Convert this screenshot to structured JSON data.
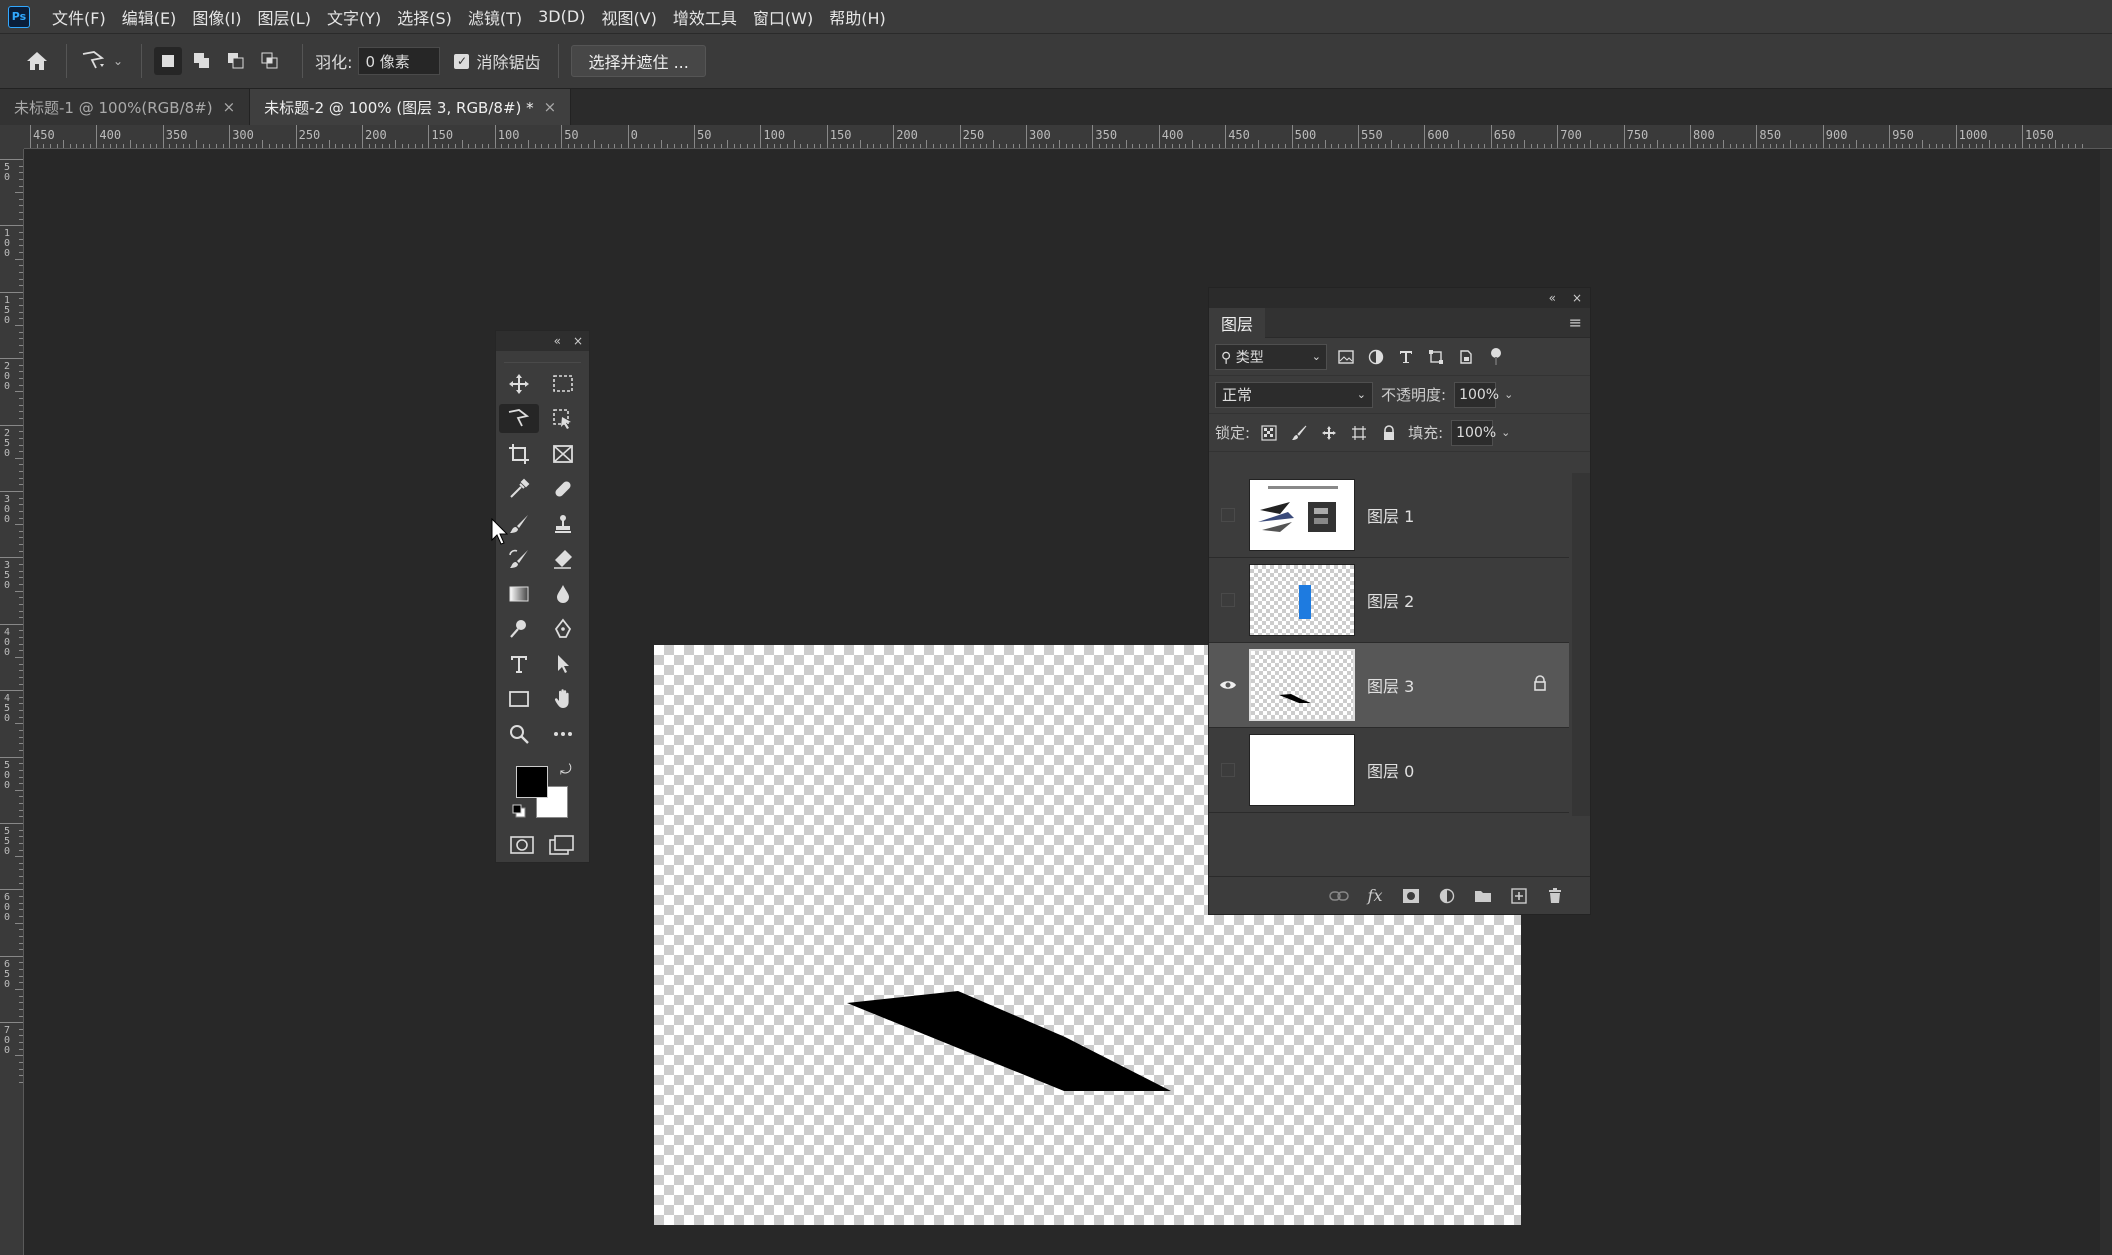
{
  "app": {
    "logo": "Ps"
  },
  "menu": [
    "文件(F)",
    "编辑(E)",
    "图像(I)",
    "图层(L)",
    "文字(Y)",
    "选择(S)",
    "滤镜(T)",
    "3D(D)",
    "视图(V)",
    "增效工具",
    "窗口(W)",
    "帮助(H)"
  ],
  "options": {
    "feather_label": "羽化:",
    "feather_value": "0 像素",
    "antialias_label": "消除锯齿",
    "antialias_checked": true,
    "select_mask_button": "选择并遮住 ..."
  },
  "tabs": [
    {
      "label": "未标题-1 @ 100%(RGB/8#)",
      "close": "×",
      "active": false
    },
    {
      "label": "未标题-2 @ 100% (图层 3, RGB/8#) *",
      "close": "×",
      "active": true
    }
  ],
  "ruler": {
    "top_labels": [
      "450",
      "400",
      "350",
      "300",
      "250",
      "200",
      "150",
      "100",
      "50",
      "0",
      "50",
      "100",
      "150",
      "200",
      "250",
      "300",
      "350",
      "400",
      "450",
      "500",
      "550",
      "600",
      "650",
      "700",
      "750",
      "800",
      "850",
      "900",
      "950",
      "1000",
      "1050"
    ],
    "left_labels": [
      "5 0",
      "1 0 0",
      "1 5 0",
      "2 0 0",
      "2 5 0",
      "3 0 0",
      "3 5 0",
      "4 0 0",
      "4 5 0",
      "5 0 0",
      "5 5 0",
      "6 0 0",
      "6 5 0",
      "7 0 0"
    ]
  },
  "toolbox": {
    "collapse": "«",
    "close": "×",
    "tools": [
      "move-tool",
      "marquee-tool",
      "polygonal-lasso-tool",
      "object-selection-tool",
      "crop-tool",
      "frame-tool",
      "eyedropper-tool",
      "spot-healing-tool",
      "brush-tool",
      "clone-stamp-tool",
      "history-brush-tool",
      "eraser-tool",
      "gradient-tool",
      "blur-tool",
      "dodge-tool",
      "pen-tool",
      "type-tool",
      "path-selection-tool",
      "rectangle-tool",
      "hand-tool",
      "zoom-tool",
      "more-tools"
    ],
    "foreground": "#000000",
    "background": "#ffffff"
  },
  "layers_panel": {
    "collapse": "«",
    "close": "×",
    "tab": "图层",
    "filter_label": "类型",
    "blend_mode": "正常",
    "opacity_label": "不透明度:",
    "opacity_value": "100%",
    "lock_label": "锁定:",
    "fill_label": "填充:",
    "fill_value": "100%",
    "layers": [
      {
        "name": "图层 1",
        "visible": false,
        "selected": false,
        "locked": false
      },
      {
        "name": "图层 2",
        "visible": false,
        "selected": false,
        "locked": false
      },
      {
        "name": "图层 3",
        "visible": true,
        "selected": true,
        "locked": true
      },
      {
        "name": "图层 0",
        "visible": false,
        "selected": false,
        "locked": false
      }
    ],
    "bottom_fx": "fx"
  },
  "colors": {
    "accent": "#31a8ff",
    "layer2_bar": "#1e7be0"
  }
}
